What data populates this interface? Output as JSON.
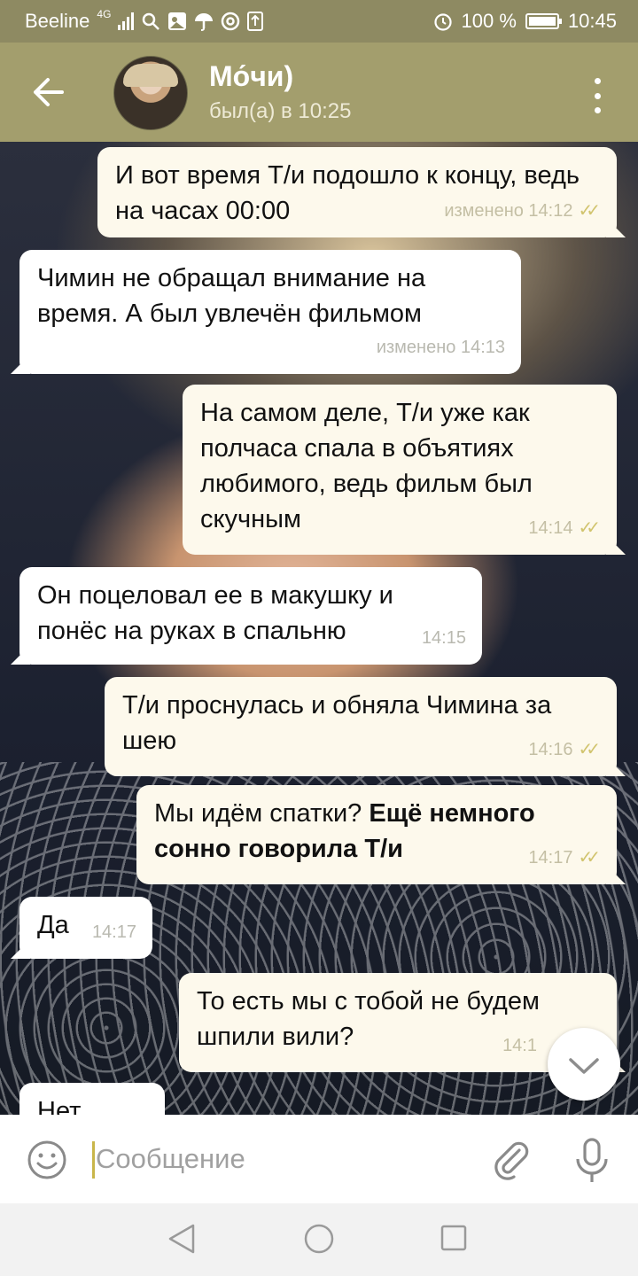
{
  "status_bar": {
    "carrier": "Beeline",
    "network": "4G",
    "battery": "100 %",
    "battery_level": 1.0,
    "time": "10:45"
  },
  "header": {
    "contact_name": "Мо́чи)",
    "contact_status": "был(а) в 10:25"
  },
  "messages": [
    {
      "direction": "out",
      "text": "И вот время Т/и подошло к концу, ведь на часах 00:00",
      "meta": "изменено 14:12",
      "read": true
    },
    {
      "direction": "in",
      "text": "Чимин не обращал внимание на время. А был увлечён фильмом",
      "meta": "изменено 14:13"
    },
    {
      "direction": "out",
      "text": "На самом деле, Т/и уже как полчаса спала в объятиях любимого, ведь фильм был скучным",
      "meta": "14:14",
      "read": true
    },
    {
      "direction": "in",
      "text": "Он поцеловал ее в макушку и понёс на руках в спальню",
      "meta": "14:15"
    },
    {
      "direction": "out",
      "text": "Т/и проснулась и обняла Чимина за шею",
      "meta": "14:16",
      "read": true
    },
    {
      "direction": "out",
      "text_normal": "Мы идём спатки? ",
      "text_bold": "Ещё немного сонно говорила Т/и",
      "meta": "14:17",
      "read": true
    },
    {
      "direction": "in",
      "text": "Да",
      "meta": "14:17"
    },
    {
      "direction": "out",
      "text": "То есть мы с тобой не будем шпили вили?",
      "meta": "14:1"
    },
    {
      "direction": "in",
      "text": "Нет",
      "meta": ""
    }
  ],
  "input": {
    "placeholder": "Сообщение"
  },
  "colors": {
    "header_bg": "#a39e6d",
    "status_bg": "#8e8a62",
    "out_bubble": "#fdf9ec",
    "in_bubble": "#ffffff",
    "read_ticks": "#d1c46e"
  },
  "icons": [
    "back-arrow-icon",
    "more-vert-icon",
    "emoji-icon",
    "attach-icon",
    "mic-icon",
    "chevron-down-icon"
  ]
}
